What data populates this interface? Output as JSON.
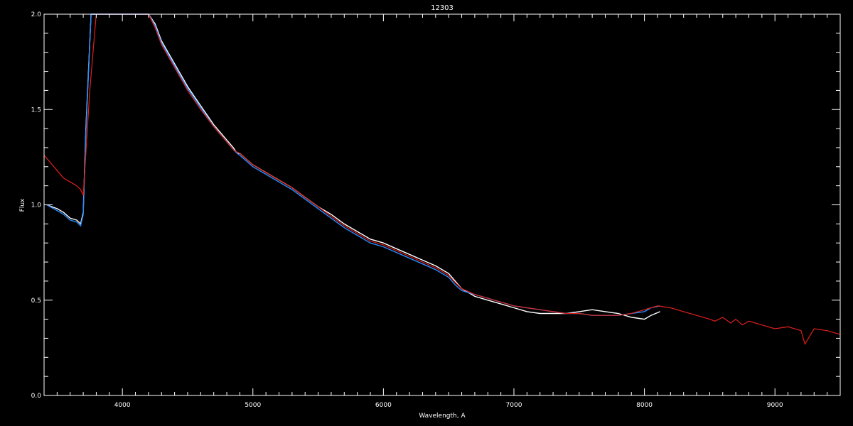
{
  "chart_data": {
    "type": "line",
    "title": "12303",
    "xlabel": "Wavelength, A",
    "ylabel": "Flux",
    "xlim": [
      3400,
      9500
    ],
    "ylim": [
      0.0,
      2.0
    ],
    "xticks": [
      4000,
      5000,
      6000,
      7000,
      8000,
      9000
    ],
    "xtick_labels": [
      "4000",
      "5000",
      "6000",
      "7000",
      "8000",
      "9000"
    ],
    "yticks": [
      0.0,
      0.5,
      1.0,
      1.5,
      2.0
    ],
    "ytick_labels": [
      "0.0",
      "0.5",
      "1.0",
      "1.5",
      "2.0"
    ],
    "grid": false,
    "background": "#000000",
    "axis_color": "#ffffff",
    "series": [
      {
        "color": "#ffffff",
        "x": [
          3420,
          3500,
          3550,
          3600,
          3650,
          3680,
          3700,
          3720,
          3760,
          3800,
          3850,
          3900,
          3950,
          4000,
          4050,
          4100,
          4150,
          4200,
          4250,
          4300,
          4350,
          4400,
          4450,
          4500,
          4550,
          4600,
          4650,
          4700,
          4750,
          4800,
          4850,
          4880,
          4900,
          4950,
          5000,
          5100,
          5200,
          5300,
          5400,
          5500,
          5600,
          5700,
          5800,
          5900,
          6000,
          6100,
          6200,
          6300,
          6400,
          6500,
          6550,
          6600,
          6700,
          6800,
          6900,
          7000,
          7100,
          7200,
          7300,
          7400,
          7500,
          7600,
          7700,
          7800,
          7900,
          8000,
          8050,
          8120
        ],
        "y": [
          1.0,
          0.98,
          0.96,
          0.93,
          0.92,
          0.9,
          0.96,
          1.4,
          2.0,
          2.0,
          2.0,
          2.0,
          2.0,
          2.0,
          2.0,
          2.0,
          2.0,
          2.0,
          1.95,
          1.86,
          1.8,
          1.74,
          1.68,
          1.62,
          1.57,
          1.52,
          1.47,
          1.42,
          1.38,
          1.34,
          1.3,
          1.27,
          1.27,
          1.24,
          1.21,
          1.17,
          1.13,
          1.09,
          1.04,
          0.99,
          0.95,
          0.9,
          0.86,
          0.82,
          0.8,
          0.77,
          0.74,
          0.71,
          0.68,
          0.64,
          0.6,
          0.56,
          0.52,
          0.5,
          0.48,
          0.46,
          0.44,
          0.43,
          0.43,
          0.43,
          0.44,
          0.45,
          0.44,
          0.43,
          0.41,
          0.4,
          0.42,
          0.44
        ]
      },
      {
        "color": "#2a8cff",
        "x": [
          3420,
          3500,
          3550,
          3600,
          3650,
          3680,
          3700,
          3720,
          3760,
          3800,
          3850,
          3900,
          3950,
          4000,
          4050,
          4100,
          4150,
          4200,
          4250,
          4300,
          4350,
          4400,
          4450,
          4500,
          4550,
          4600,
          4650,
          4700,
          4750,
          4800,
          4850,
          4880,
          4900,
          4950,
          5000,
          5100,
          5200,
          5300,
          5400,
          5500,
          5600,
          5700,
          5800,
          5900,
          6000,
          6100,
          6200,
          6300,
          6400,
          6500,
          6550,
          6600,
          6700,
          6800,
          6900,
          7000,
          7100,
          7200,
          7300,
          7400,
          7500,
          7600,
          7700,
          7800,
          7900,
          8000,
          8050,
          8120
        ],
        "y": [
          1.0,
          0.97,
          0.95,
          0.92,
          0.91,
          0.89,
          0.95,
          1.38,
          2.0,
          2.0,
          2.0,
          2.0,
          2.0,
          2.0,
          2.0,
          2.0,
          2.0,
          2.0,
          1.94,
          1.85,
          1.79,
          1.73,
          1.67,
          1.61,
          1.56,
          1.51,
          1.46,
          1.41,
          1.37,
          1.33,
          1.29,
          1.27,
          1.26,
          1.23,
          1.2,
          1.16,
          1.12,
          1.08,
          1.03,
          0.98,
          0.93,
          0.88,
          0.84,
          0.8,
          0.78,
          0.75,
          0.72,
          0.69,
          0.66,
          0.62,
          0.58,
          0.55,
          0.53,
          0.51,
          0.49,
          0.47,
          0.46,
          0.45,
          0.44,
          0.43,
          0.43,
          0.42,
          0.42,
          0.42,
          0.43,
          0.44,
          0.46,
          0.47
        ]
      },
      {
        "color": "#e0201a",
        "x": [
          3400,
          3450,
          3500,
          3550,
          3600,
          3650,
          3680,
          3700,
          3750,
          3800,
          3850,
          3900,
          3950,
          4000,
          4050,
          4100,
          4150,
          4200,
          4250,
          4300,
          4350,
          4400,
          4450,
          4500,
          4600,
          4700,
          4800,
          4850,
          4870,
          4900,
          5000,
          5100,
          5200,
          5300,
          5400,
          5500,
          5600,
          5700,
          5800,
          5900,
          6000,
          6100,
          6200,
          6300,
          6400,
          6500,
          6540,
          6600,
          6700,
          6800,
          6900,
          7000,
          7100,
          7200,
          7300,
          7400,
          7500,
          7600,
          7700,
          7800,
          7900,
          8000,
          8100,
          8200,
          8300,
          8400,
          8500,
          8540,
          8600,
          8660,
          8700,
          8750,
          8800,
          8900,
          9000,
          9100,
          9200,
          9230,
          9300,
          9400,
          9500
        ],
        "y": [
          1.26,
          1.22,
          1.18,
          1.14,
          1.12,
          1.1,
          1.08,
          1.05,
          1.6,
          2.0,
          2.0,
          2.0,
          2.0,
          2.0,
          2.0,
          2.0,
          2.0,
          2.0,
          1.93,
          1.84,
          1.78,
          1.72,
          1.66,
          1.6,
          1.5,
          1.41,
          1.33,
          1.29,
          1.28,
          1.27,
          1.21,
          1.17,
          1.13,
          1.09,
          1.04,
          0.99,
          0.94,
          0.89,
          0.85,
          0.81,
          0.79,
          0.76,
          0.73,
          0.7,
          0.67,
          0.63,
          0.6,
          0.56,
          0.53,
          0.51,
          0.49,
          0.47,
          0.46,
          0.45,
          0.44,
          0.43,
          0.43,
          0.42,
          0.42,
          0.42,
          0.43,
          0.45,
          0.47,
          0.46,
          0.44,
          0.42,
          0.4,
          0.39,
          0.41,
          0.38,
          0.4,
          0.37,
          0.39,
          0.37,
          0.35,
          0.36,
          0.34,
          0.27,
          0.35,
          0.34,
          0.32
        ]
      }
    ]
  }
}
